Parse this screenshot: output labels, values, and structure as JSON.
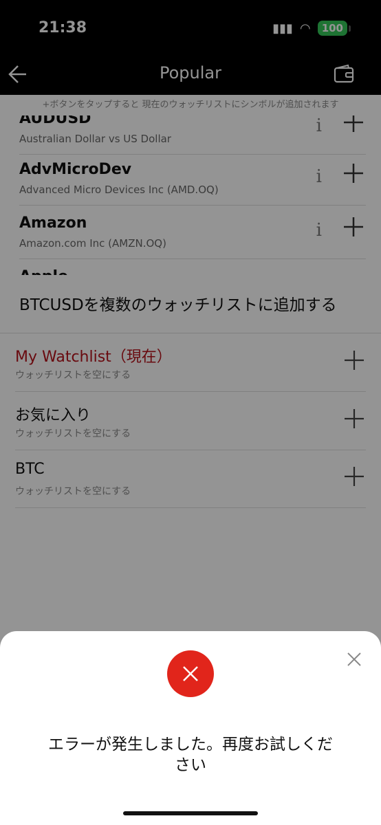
{
  "status": {
    "time": "21:38",
    "battery": "100"
  },
  "nav": {
    "title": "Popular"
  },
  "hint": "+ボタンをタップすると 現在のウォッチリストにシンボルが追加されます",
  "symbols": [
    {
      "name": "AUDUSD",
      "desc": "Australian Dollar vs US Dollar"
    },
    {
      "name": "AdvMicroDev",
      "desc": "Advanced Micro Devices Inc (AMD.OQ)"
    },
    {
      "name": "Amazon",
      "desc": "Amazon.com Inc (AMZN.OQ)"
    },
    {
      "name": "Apple",
      "desc": ""
    }
  ],
  "info_glyph": "i",
  "watchlist_sheet": {
    "title": "BTCUSDを複数のウォッチリストに追加する",
    "items": [
      {
        "name": "My Watchlist（現在）",
        "sub": "ウォッチリストを空にする",
        "current": true
      },
      {
        "name": "お気に入り",
        "sub": "ウォッチリストを空にする",
        "current": false
      },
      {
        "name": "BTC",
        "sub": "ウォッチリストを空にする",
        "current": false
      }
    ]
  },
  "error": {
    "message": "エラーが発生しました。再度お試しください"
  },
  "colors": {
    "accent_red": "#e1251b",
    "current_text": "#b5121b",
    "battery": "#34c759"
  },
  "icons": {
    "back": "arrow-left-icon",
    "wallet": "wallet-icon",
    "plus": "plus-icon",
    "close": "close-icon",
    "error": "x-circle-icon"
  }
}
